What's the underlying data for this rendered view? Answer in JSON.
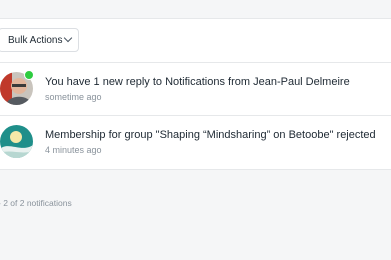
{
  "toolbar": {
    "bulk_actions_label": "Bulk Actions"
  },
  "notifications": [
    {
      "message": "You have 1 new reply to Notifications from Jean-Paul Delmeire",
      "time": "sometime ago",
      "avatar_icon": "user-photo",
      "online": true
    },
    {
      "message": "Membership for group \"Shaping “Mindsharing” on Betoobe\" rejected",
      "time": "4 minutes ago",
      "avatar_icon": "group-photo",
      "online": false
    }
  ],
  "footer": {
    "count_text": "- 2 of 2 notifications"
  },
  "colors": {
    "online": "#2ecc40",
    "text": "#1e2933",
    "muted": "#8a939c"
  }
}
